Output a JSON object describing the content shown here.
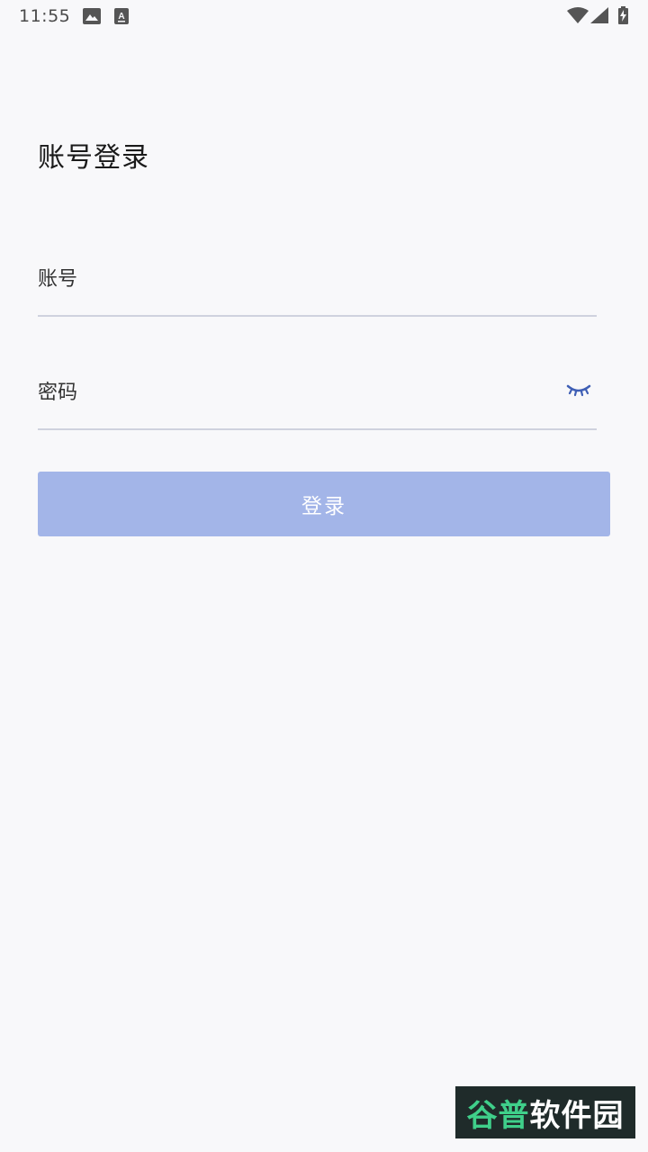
{
  "status_bar": {
    "time": "11:55",
    "icons": [
      "image-notification-icon",
      "keyboard-a-icon",
      "wifi-icon",
      "cell-signal-icon",
      "battery-charging-icon"
    ]
  },
  "login": {
    "title": "账号登录",
    "account_placeholder": "账号",
    "password_placeholder": "密码",
    "submit_label": "登录",
    "colors": {
      "button_bg": "#a3b5e8",
      "field_underline": "#cfd2de",
      "eye_icon": "#3f5fb5"
    }
  },
  "watermark": {
    "part1": "谷普",
    "part2": "软件园"
  }
}
